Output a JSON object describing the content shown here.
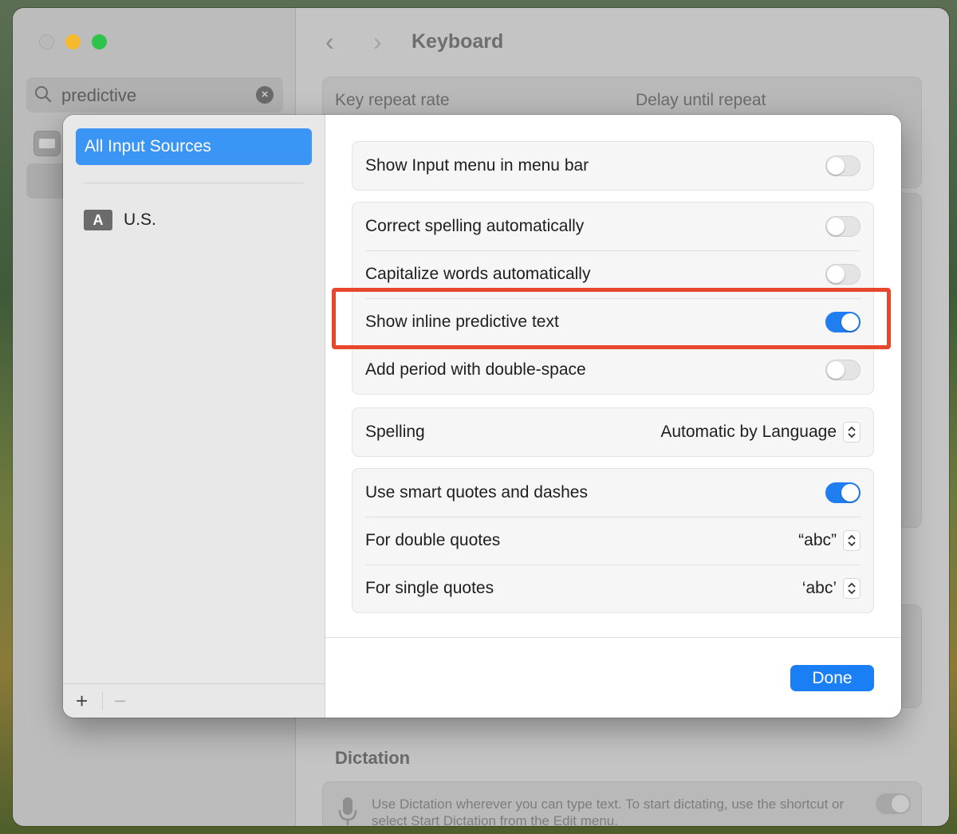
{
  "background_window": {
    "search_value": "predictive",
    "title": "Keyboard",
    "key_repeat_label": "Key repeat rate",
    "delay_label": "Delay until repeat",
    "dictation_heading": "Dictation",
    "dictation_text": "Use Dictation wherever you can type text. To start dictating, use the shortcut or select Start Dictation from the Edit menu."
  },
  "sheet": {
    "sidebar": {
      "selected_item": "All Input Sources",
      "languages": [
        {
          "badge": "A",
          "label": "U.S."
        }
      ],
      "add_label": "+",
      "remove_label": "−"
    },
    "groups": {
      "input_menu": {
        "label": "Show Input menu in menu bar",
        "on": false
      },
      "auto": [
        {
          "label": "Correct spelling automatically",
          "on": false
        },
        {
          "label": "Capitalize words automatically",
          "on": false
        },
        {
          "label": "Show inline predictive text",
          "on": true
        },
        {
          "label": "Add period with double-space",
          "on": false
        }
      ],
      "spelling": {
        "label": "Spelling",
        "value": "Automatic by Language"
      },
      "quotes": {
        "smart_label": "Use smart quotes and dashes",
        "smart_on": true,
        "double_label": "For double quotes",
        "double_value": "“abc”",
        "single_label": "For single quotes",
        "single_value": "‘abc’"
      }
    },
    "done_label": "Done"
  },
  "colors": {
    "accent": "#1a7ef5",
    "toggle_on": "#1f7ef0",
    "selection": "#3a95f5",
    "highlight_box": "#e8472d"
  }
}
